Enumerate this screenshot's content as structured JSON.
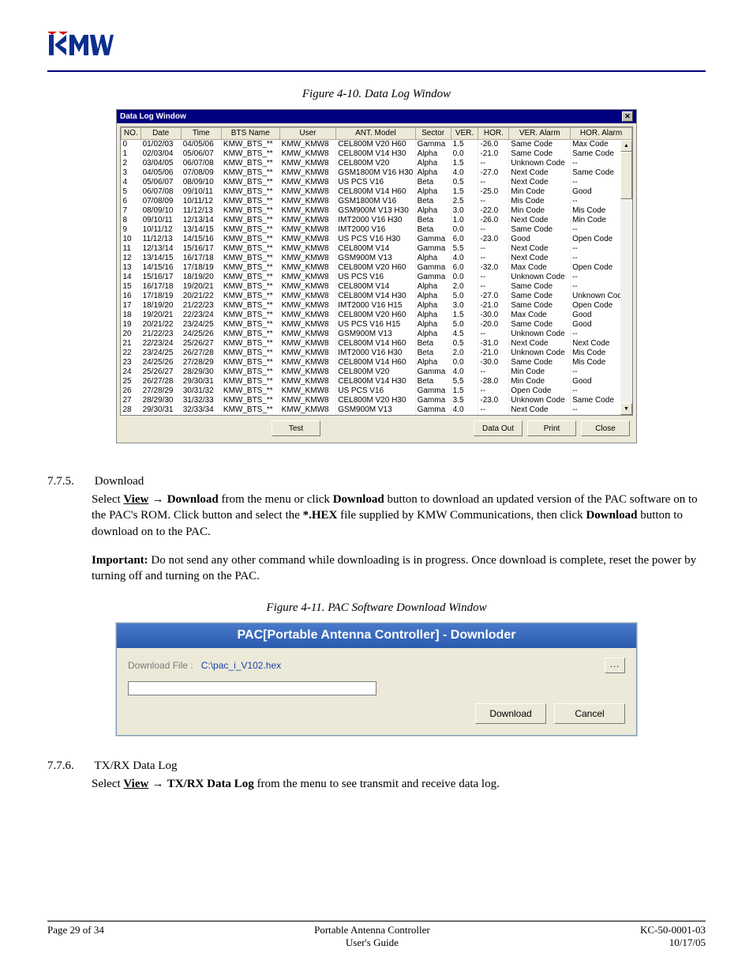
{
  "figure1_caption": "Figure 4-10. Data Log Window",
  "figure2_caption": "Figure 4-11. PAC Software Download Window",
  "dlg": {
    "title": "Data Log Window",
    "columns": [
      "NO.",
      "Date",
      "Time",
      "BTS Name",
      "User",
      "ANT. Model",
      "Sector",
      "VER.",
      "HOR.",
      "VER. Alarm",
      "HOR. Alarm"
    ],
    "buttons": {
      "test": "Test",
      "data_out": "Data Out",
      "print": "Print",
      "close": "Close"
    }
  },
  "rows": [
    {
      "no": "0",
      "date": "01/02/03",
      "time": "04/05/06",
      "bts": "KMW_BTS_**",
      "user": "KMW_KMW8",
      "ant": "CEL800M V20 H60",
      "sector": "Gamma",
      "ver": "1.5",
      "hor": "-26.0",
      "va": "Same Code",
      "ha": "Max Code"
    },
    {
      "no": "1",
      "date": "02/03/04",
      "time": "05/06/07",
      "bts": "KMW_BTS_**",
      "user": "KMW_KMW8",
      "ant": "CEL800M V14 H30",
      "sector": "Alpha",
      "ver": "0.0",
      "hor": "-21.0",
      "va": "Same Code",
      "ha": "Same Code"
    },
    {
      "no": "2",
      "date": "03/04/05",
      "time": "06/07/08",
      "bts": "KMW_BTS_**",
      "user": "KMW_KMW8",
      "ant": "CEL800M V20",
      "sector": "Alpha",
      "ver": "1.5",
      "hor": "--",
      "va": "Unknown Code",
      "ha": "--"
    },
    {
      "no": "3",
      "date": "04/05/06",
      "time": "07/08/09",
      "bts": "KMW_BTS_**",
      "user": "KMW_KMW8",
      "ant": "GSM1800M V16 H30",
      "sector": "Alpha",
      "ver": "4.0",
      "hor": "-27.0",
      "va": "Next Code",
      "ha": "Same Code"
    },
    {
      "no": "4",
      "date": "05/06/07",
      "time": "08/09/10",
      "bts": "KMW_BTS_**",
      "user": "KMW_KMW8",
      "ant": "US PCS V16",
      "sector": "Beta",
      "ver": "0.5",
      "hor": "--",
      "va": "Next Code",
      "ha": "--"
    },
    {
      "no": "5",
      "date": "06/07/08",
      "time": "09/10/11",
      "bts": "KMW_BTS_**",
      "user": "KMW_KMW8",
      "ant": "CEL800M V14 H60",
      "sector": "Alpha",
      "ver": "1.5",
      "hor": "-25.0",
      "va": "Min Code",
      "ha": "Good"
    },
    {
      "no": "6",
      "date": "07/08/09",
      "time": "10/11/12",
      "bts": "KMW_BTS_**",
      "user": "KMW_KMW8",
      "ant": "GSM1800M V16",
      "sector": "Beta",
      "ver": "2.5",
      "hor": "--",
      "va": "Mis Code",
      "ha": "--"
    },
    {
      "no": "7",
      "date": "08/09/10",
      "time": "11/12/13",
      "bts": "KMW_BTS_**",
      "user": "KMW_KMW8",
      "ant": "GSM900M V13 H30",
      "sector": "Alpha",
      "ver": "3.0",
      "hor": "-22.0",
      "va": "Min Code",
      "ha": "Mis Code"
    },
    {
      "no": "8",
      "date": "09/10/11",
      "time": "12/13/14",
      "bts": "KMW_BTS_**",
      "user": "KMW_KMW8",
      "ant": "IMT2000 V16 H30",
      "sector": "Beta",
      "ver": "1.0",
      "hor": "-26.0",
      "va": "Next Code",
      "ha": "Min Code"
    },
    {
      "no": "9",
      "date": "10/11/12",
      "time": "13/14/15",
      "bts": "KMW_BTS_**",
      "user": "KMW_KMW8",
      "ant": "IMT2000 V16",
      "sector": "Beta",
      "ver": "0.0",
      "hor": "--",
      "va": "Same Code",
      "ha": "--"
    },
    {
      "no": "10",
      "date": "11/12/13",
      "time": "14/15/16",
      "bts": "KMW_BTS_**",
      "user": "KMW_KMW8",
      "ant": "US PCS V16 H30",
      "sector": "Gamma",
      "ver": "6.0",
      "hor": "-23.0",
      "va": "Good",
      "ha": "Open Code"
    },
    {
      "no": "11",
      "date": "12/13/14",
      "time": "15/16/17",
      "bts": "KMW_BTS_**",
      "user": "KMW_KMW8",
      "ant": "CEL800M V14",
      "sector": "Gamma",
      "ver": "5.5",
      "hor": "--",
      "va": "Next Code",
      "ha": "--"
    },
    {
      "no": "12",
      "date": "13/14/15",
      "time": "16/17/18",
      "bts": "KMW_BTS_**",
      "user": "KMW_KMW8",
      "ant": "GSM900M V13",
      "sector": "Alpha",
      "ver": "4.0",
      "hor": "--",
      "va": "Next Code",
      "ha": "--"
    },
    {
      "no": "13",
      "date": "14/15/16",
      "time": "17/18/19",
      "bts": "KMW_BTS_**",
      "user": "KMW_KMW8",
      "ant": "CEL800M V20 H60",
      "sector": "Gamma",
      "ver": "6.0",
      "hor": "-32.0",
      "va": "Max Code",
      "ha": "Open Code"
    },
    {
      "no": "14",
      "date": "15/16/17",
      "time": "18/19/20",
      "bts": "KMW_BTS_**",
      "user": "KMW_KMW8",
      "ant": "US PCS V16",
      "sector": "Gamma",
      "ver": "0.0",
      "hor": "--",
      "va": "Unknown Code",
      "ha": "--"
    },
    {
      "no": "15",
      "date": "16/17/18",
      "time": "19/20/21",
      "bts": "KMW_BTS_**",
      "user": "KMW_KMW8",
      "ant": "CEL800M V14",
      "sector": "Alpha",
      "ver": "2.0",
      "hor": "--",
      "va": "Same Code",
      "ha": "--"
    },
    {
      "no": "16",
      "date": "17/18/19",
      "time": "20/21/22",
      "bts": "KMW_BTS_**",
      "user": "KMW_KMW8",
      "ant": "CEL800M V14 H30",
      "sector": "Alpha",
      "ver": "5.0",
      "hor": "-27.0",
      "va": "Same Code",
      "ha": "Unknown Code"
    },
    {
      "no": "17",
      "date": "18/19/20",
      "time": "21/22/23",
      "bts": "KMW_BTS_**",
      "user": "KMW_KMW8",
      "ant": "IMT2000 V16 H15",
      "sector": "Alpha",
      "ver": "3.0",
      "hor": "-21.0",
      "va": "Same Code",
      "ha": "Open Code"
    },
    {
      "no": "18",
      "date": "19/20/21",
      "time": "22/23/24",
      "bts": "KMW_BTS_**",
      "user": "KMW_KMW8",
      "ant": "CEL800M V20 H60",
      "sector": "Alpha",
      "ver": "1.5",
      "hor": "-30.0",
      "va": "Max Code",
      "ha": "Good"
    },
    {
      "no": "19",
      "date": "20/21/22",
      "time": "23/24/25",
      "bts": "KMW_BTS_**",
      "user": "KMW_KMW8",
      "ant": "US PCS V16 H15",
      "sector": "Alpha",
      "ver": "5.0",
      "hor": "-20.0",
      "va": "Same Code",
      "ha": "Good"
    },
    {
      "no": "20",
      "date": "21/22/23",
      "time": "24/25/26",
      "bts": "KMW_BTS_**",
      "user": "KMW_KMW8",
      "ant": "GSM900M V13",
      "sector": "Alpha",
      "ver": "4.5",
      "hor": "--",
      "va": "Unknown Code",
      "ha": "--"
    },
    {
      "no": "21",
      "date": "22/23/24",
      "time": "25/26/27",
      "bts": "KMW_BTS_**",
      "user": "KMW_KMW8",
      "ant": "CEL800M V14 H60",
      "sector": "Beta",
      "ver": "0.5",
      "hor": "-31.0",
      "va": "Next Code",
      "ha": "Next Code"
    },
    {
      "no": "22",
      "date": "23/24/25",
      "time": "26/27/28",
      "bts": "KMW_BTS_**",
      "user": "KMW_KMW8",
      "ant": "IMT2000 V16 H30",
      "sector": "Beta",
      "ver": "2.0",
      "hor": "-21.0",
      "va": "Unknown Code",
      "ha": "Mis Code"
    },
    {
      "no": "23",
      "date": "24/25/26",
      "time": "27/28/29",
      "bts": "KMW_BTS_**",
      "user": "KMW_KMW8",
      "ant": "CEL800M V14 H60",
      "sector": "Alpha",
      "ver": "0.0",
      "hor": "-30.0",
      "va": "Same Code",
      "ha": "Mis Code"
    },
    {
      "no": "24",
      "date": "25/26/27",
      "time": "28/29/30",
      "bts": "KMW_BTS_**",
      "user": "KMW_KMW8",
      "ant": "CEL800M V20",
      "sector": "Gamma",
      "ver": "4.0",
      "hor": "--",
      "va": "Min Code",
      "ha": "--"
    },
    {
      "no": "25",
      "date": "26/27/28",
      "time": "29/30/31",
      "bts": "KMW_BTS_**",
      "user": "KMW_KMW8",
      "ant": "CEL800M V14 H30",
      "sector": "Beta",
      "ver": "5.5",
      "hor": "-28.0",
      "va": "Min Code",
      "ha": "Good"
    },
    {
      "no": "26",
      "date": "27/28/29",
      "time": "30/31/32",
      "bts": "KMW_BTS_**",
      "user": "KMW_KMW8",
      "ant": "US PCS V16",
      "sector": "Gamma",
      "ver": "1.5",
      "hor": "--",
      "va": "Open Code",
      "ha": "--"
    },
    {
      "no": "27",
      "date": "28/29/30",
      "time": "31/32/33",
      "bts": "KMW_BTS_**",
      "user": "KMW_KMW8",
      "ant": "CEL800M V20 H30",
      "sector": "Gamma",
      "ver": "3.5",
      "hor": "-23.0",
      "va": "Unknown Code",
      "ha": "Same Code"
    },
    {
      "no": "28",
      "date": "29/30/31",
      "time": "32/33/34",
      "bts": "KMW_BTS_**",
      "user": "KMW_KMW8",
      "ant": "GSM900M V13",
      "sector": "Gamma",
      "ver": "4.0",
      "hor": "--",
      "va": "Next Code",
      "ha": "--"
    }
  ],
  "s775": {
    "num": "7.7.5.",
    "title": "Download",
    "p1_a": "Select ",
    "p1_view": "View",
    "p1_arrow": " → ",
    "p1_dl1": "Download",
    "p1_b": " from the menu or click ",
    "p1_dl2": "Download",
    "p1_c": " button to download an updated version of the PAC software on to the PAC's ROM. Click button and select the ",
    "p1_hex": "*.HEX",
    "p1_d": " file supplied by KMW Communications, then click ",
    "p1_dl3": "Download",
    "p1_e": " button to download on to the PAC.",
    "p2_imp": "Important:",
    "p2_txt": " Do not send any other command while downloading is in progress. Once download is complete, reset the power by turning off and turning on the PAC."
  },
  "pac": {
    "title_a": "PAC[Portable Antenna Controller]",
    "title_b": " - Downloder",
    "label": "Download File :",
    "file": "C:\\pac_i_V102.hex",
    "browse": "...",
    "download": "Download",
    "cancel": "Cancel"
  },
  "s776": {
    "num": "7.7.6.",
    "title": "TX/RX Data Log",
    "p_a": "Select ",
    "p_view": "View",
    "p_arrow": " → ",
    "p_b": "TX/RX Data Log",
    "p_c": " from the menu to see transmit and receive data log."
  },
  "footer": {
    "left": "Page 29 of 34",
    "mid1": "Portable Antenna Controller",
    "mid2": "User's Guide",
    "right1": "KC-50-0001-03",
    "right2": "10/17/05"
  }
}
